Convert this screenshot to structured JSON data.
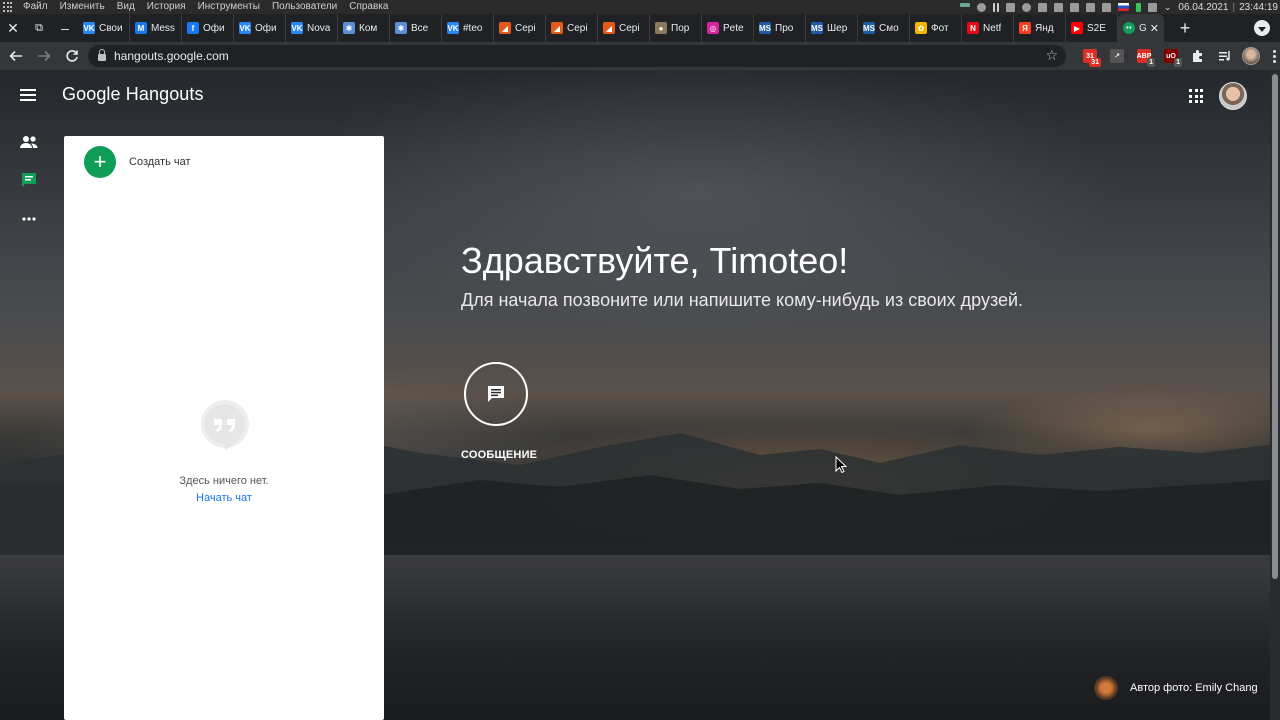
{
  "os": {
    "menu": [
      "Файл",
      "Изменить",
      "Вид",
      "История",
      "Инструменты",
      "Пользователи",
      "Справка"
    ],
    "date": "06.04.2021",
    "time": "23:44:19"
  },
  "tabs": [
    {
      "label": "Свои",
      "favicon_color": "#2787f5",
      "favicon_text": "VK"
    },
    {
      "label": "Mess",
      "favicon_color": "#1877f2",
      "favicon_text": "M"
    },
    {
      "label": "Офи",
      "favicon_color": "#1877f2",
      "favicon_text": "f"
    },
    {
      "label": "Офи",
      "favicon_color": "#2787f5",
      "favicon_text": "VK"
    },
    {
      "label": "Nova",
      "favicon_color": "#2787f5",
      "favicon_text": "VK"
    },
    {
      "label": "Ком",
      "favicon_color": "#5b8fd6",
      "favicon_text": "✱"
    },
    {
      "label": "Все",
      "favicon_color": "#5b8fd6",
      "favicon_text": "✱"
    },
    {
      "label": "#teo",
      "favicon_color": "#2787f5",
      "favicon_text": "VK"
    },
    {
      "label": "Серi",
      "favicon_color": "#e25b1a",
      "favicon_text": "◢"
    },
    {
      "label": "Серi",
      "favicon_color": "#e25b1a",
      "favicon_text": "◢"
    },
    {
      "label": "Серi",
      "favicon_color": "#e25b1a",
      "favicon_text": "◢"
    },
    {
      "label": "Пор",
      "favicon_color": "#8a7a5a",
      "favicon_text": "●"
    },
    {
      "label": "Pete",
      "favicon_color": "#d6249f",
      "favicon_text": "◎"
    },
    {
      "label": "Про",
      "favicon_color": "#1e5aa8",
      "favicon_text": "MS"
    },
    {
      "label": "Шер",
      "favicon_color": "#1e5aa8",
      "favicon_text": "MS"
    },
    {
      "label": "Смо",
      "favicon_color": "#1e5aa8",
      "favicon_text": "MS"
    },
    {
      "label": "Фот",
      "favicon_color": "#f4b400",
      "favicon_text": "✿"
    },
    {
      "label": "Netf",
      "favicon_color": "#e50914",
      "favicon_text": "N"
    },
    {
      "label": "Янд",
      "favicon_color": "#fc3f1d",
      "favicon_text": "Я"
    },
    {
      "label": "S2E",
      "favicon_color": "#ff0000",
      "favicon_text": "▶"
    }
  ],
  "active_tab": {
    "label": "G",
    "favicon_color": "#0f9d58"
  },
  "address_bar": {
    "url": "hangouts.google.com"
  },
  "extensions": [
    {
      "name": "calendar-ext",
      "color": "#d93025",
      "text": "31",
      "badge": "31"
    },
    {
      "name": "arrow-ext",
      "color": "#555",
      "text": "↗",
      "badge": ""
    },
    {
      "name": "adblock-ext",
      "color": "#d93025",
      "text": "ABP",
      "badge": "1"
    },
    {
      "name": "ublock-ext",
      "color": "#800000",
      "text": "uO",
      "badge": "1"
    }
  ],
  "app": {
    "logo_google": "Google",
    "logo_hangouts": "Hangouts"
  },
  "panel": {
    "create_chat": "Создать чат",
    "empty_text": "Здесь ничего нет.",
    "start_chat": "Начать чат"
  },
  "main": {
    "greeting": "Здравствуйте, Timoteo!",
    "subtitle": "Для начала позвоните или напишите кому-нибудь из своих друзей.",
    "message_label": "СООБЩЕНИЕ"
  },
  "credit": {
    "text": "Автор фото: Emily Chang"
  },
  "colors": {
    "accent_green": "#0f9d58",
    "link_blue": "#1a73e8"
  }
}
